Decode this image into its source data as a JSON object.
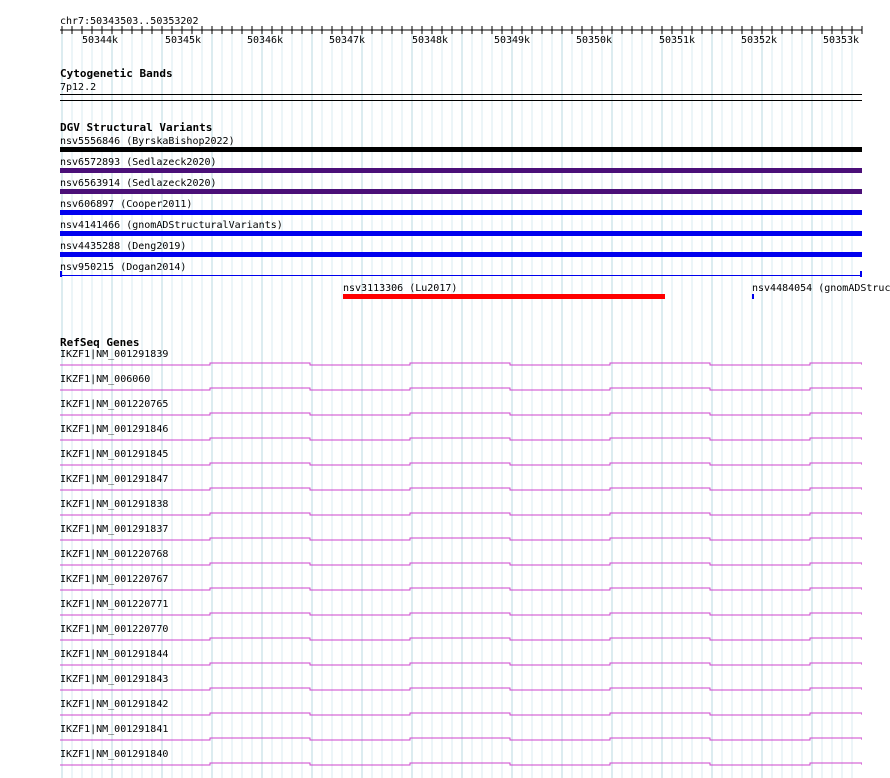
{
  "coords": "chr7:50343503..50353202",
  "ruler": {
    "labels": [
      "50344k",
      "50345k",
      "50346k",
      "50347k",
      "50348k",
      "50349k",
      "50350k",
      "50351k",
      "50352k",
      "50353k"
    ]
  },
  "cyto": {
    "title": "Cytogenetic Bands",
    "band": "7p12.2"
  },
  "dgv": {
    "title": "DGV Structural Variants",
    "tracks": [
      {
        "label": "nsv5556846 (ByrskaBishop2022)",
        "color": "#000000"
      },
      {
        "label": "nsv6572893 (Sedlazeck2020)",
        "color": "#4a0f78"
      },
      {
        "label": "nsv6563914 (Sedlazeck2020)",
        "color": "#4a0f78"
      },
      {
        "label": "nsv606897 (Cooper2011)",
        "color": "#0000ee"
      },
      {
        "label": "nsv4141466 (gnomADStructuralVariants)",
        "color": "#0000ee"
      },
      {
        "label": "nsv4435288 (Deng2019)",
        "color": "#0000ee"
      },
      {
        "label": "nsv950215 (Dogan2014)",
        "color": "#0000ee"
      }
    ],
    "extra": [
      {
        "label": "nsv3113306 (Lu2017)",
        "color": "#ff0000"
      },
      {
        "label": "nsv4484054 (gnomADStruc",
        "color": "#0000ee"
      }
    ]
  },
  "refseq": {
    "title": "RefSeq Genes",
    "color": "#cc44cc",
    "genes": [
      "IKZF1|NM_001291839",
      "IKZF1|NM_006060",
      "IKZF1|NM_001220765",
      "IKZF1|NM_001291846",
      "IKZF1|NM_001291845",
      "IKZF1|NM_001291847",
      "IKZF1|NM_001291838",
      "IKZF1|NM_001291837",
      "IKZF1|NM_001220768",
      "IKZF1|NM_001220767",
      "IKZF1|NM_001220771",
      "IKZF1|NM_001220770",
      "IKZF1|NM_001291844",
      "IKZF1|NM_001291843",
      "IKZF1|NM_001291842",
      "IKZF1|NM_001291841",
      "IKZF1|NM_001291840"
    ]
  }
}
